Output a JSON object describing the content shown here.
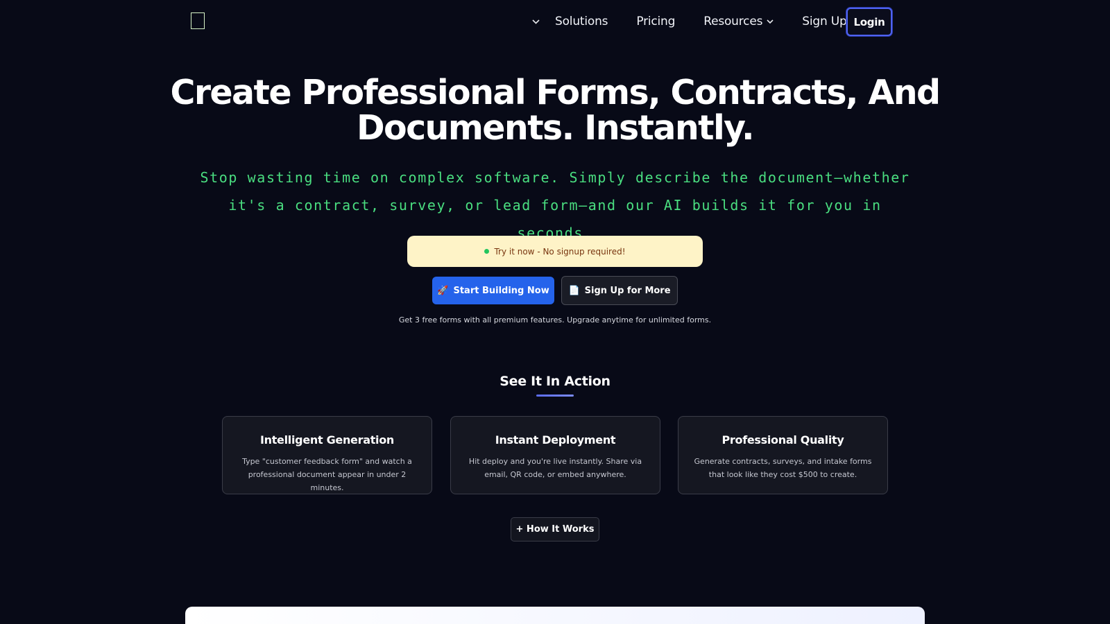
{
  "nav": {
    "links": [
      {
        "label": "Solutions"
      },
      {
        "label": "Pricing"
      },
      {
        "label": "Resources"
      },
      {
        "label": "Sign Up"
      }
    ],
    "login_label": "Login"
  },
  "hero": {
    "title_line1": "Create Professional Forms, Contracts, And",
    "title_line2": "Documents. Instantly.",
    "subtitle": "Stop wasting time on complex software. Simply describe the document—whether it's a contract, survey, or lead form—and our AI builds it for you in seconds.",
    "try_pill": "Try it now - No signup required!",
    "primary_button": "Start Building Now",
    "primary_button_icon": "🚀",
    "secondary_button": "Sign Up for More",
    "secondary_button_icon": "📄",
    "free_note": "Get 3 free forms with all premium features. Upgrade anytime for unlimited forms."
  },
  "section": {
    "title": "See It In Action",
    "cards": [
      {
        "title": "Intelligent Generation",
        "text": "Type \"customer feedback form\" and watch a professional document appear in under 2 minutes."
      },
      {
        "title": "Instant Deployment",
        "text": "Hit deploy and you're live instantly. Share via email, QR code, or embed anywhere."
      },
      {
        "title": "Professional Quality",
        "text": "Generate contracts, surveys, and intake forms that look like they cost $500 to create."
      }
    ],
    "how_button": "+ How It Works"
  },
  "colors": {
    "background": "#080a17",
    "accent_green": "#4ade80",
    "primary_blue": "#2563eb",
    "pill_yellow": "#fef3c7"
  }
}
